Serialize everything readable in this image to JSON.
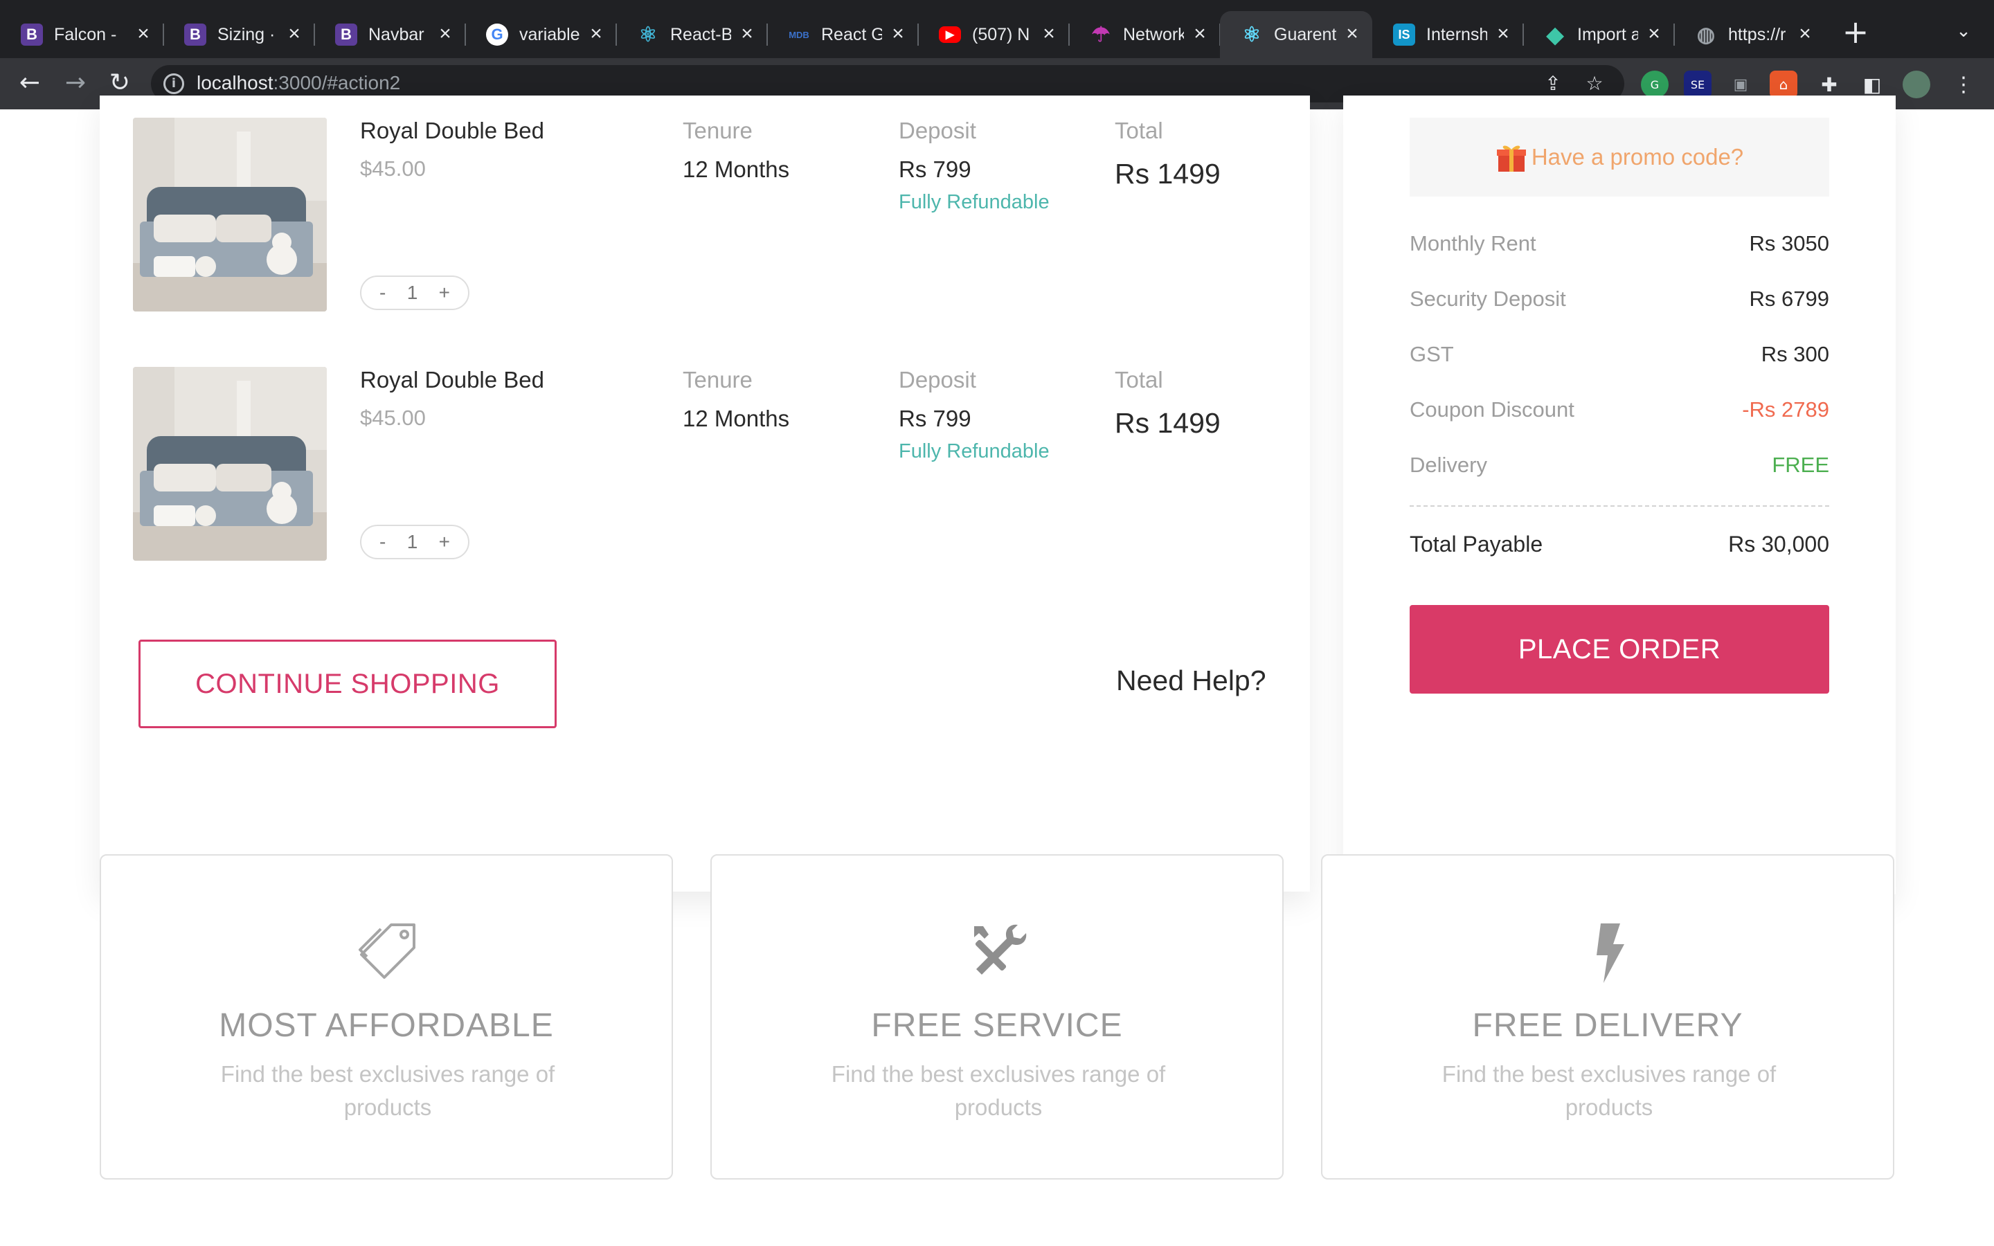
{
  "browser": {
    "tabs": [
      {
        "title": "Falcon -",
        "icon": "bootstrap-icon",
        "color": "#7952b3",
        "glyph": "B"
      },
      {
        "title": "Sizing ·",
        "icon": "bootstrap-icon",
        "color": "#7952b3",
        "glyph": "B"
      },
      {
        "title": "Navbar",
        "icon": "bootstrap-icon",
        "color": "#7952b3",
        "glyph": "B"
      },
      {
        "title": "variable",
        "icon": "google-icon",
        "color": "#ffffff",
        "glyph": "G"
      },
      {
        "title": "React-B",
        "icon": "react-bootstrap-icon",
        "color": "#41b3d3",
        "glyph": "⚛"
      },
      {
        "title": "React G",
        "icon": "mdb-icon",
        "color": "#3b71ca",
        "glyph": "MDB"
      },
      {
        "title": "(507) N",
        "icon": "youtube-icon",
        "color": "#ff0000",
        "glyph": "▶"
      },
      {
        "title": "Network",
        "icon": "umbrella-icon",
        "color": "#c239b3",
        "glyph": "☂"
      },
      {
        "title": "Guarent",
        "icon": "react-icon",
        "color": "#61dafb",
        "glyph": "⚛"
      },
      {
        "title": "Internsh",
        "icon": "internshala-icon",
        "color": "#1295c9",
        "glyph": "IS"
      },
      {
        "title": "Import a",
        "icon": "diamond-icon",
        "color": "#3ec6a8",
        "glyph": "◆"
      },
      {
        "title": "https://r",
        "icon": "globe-icon",
        "color": "#9aa0a6",
        "glyph": "◍"
      }
    ],
    "active_tab": 8,
    "url_host": "localhost",
    "url_rest": ":3000/#action2"
  },
  "cart": {
    "items": [
      {
        "name": "Royal Double Bed",
        "price": "$45.00",
        "tenure_label": "Tenure",
        "tenure": "12 Months",
        "deposit_label": "Deposit",
        "deposit": "Rs 799",
        "refund": "Fully Refundable",
        "total_label": "Total",
        "total": "Rs 1499",
        "qty": "1"
      },
      {
        "name": "Royal Double Bed",
        "price": "$45.00",
        "tenure_label": "Tenure",
        "tenure": "12 Months",
        "deposit_label": "Deposit",
        "deposit": "Rs 799",
        "refund": "Fully Refundable",
        "total_label": "Total",
        "total": "Rs 1499",
        "qty": "1"
      }
    ],
    "qty_minus": "-",
    "qty_plus": "+",
    "continue_label": "CONTINUE SHOPPING",
    "help_label": "Need Help?"
  },
  "summary": {
    "promo_label": "Have a promo code?",
    "rows": [
      {
        "label": "Monthly Rent",
        "value": "Rs 3050"
      },
      {
        "label": "Security Deposit",
        "value": "Rs 6799"
      },
      {
        "label": "GST",
        "value": "Rs 300"
      },
      {
        "label": "Coupon Discount",
        "value": "-Rs 2789"
      },
      {
        "label": "Delivery",
        "value": "FREE"
      }
    ],
    "total_label": "Total Payable",
    "total_value": "Rs 30,000",
    "place_order_label": "PLACE ORDER",
    "colors": {
      "discount": "#f06a4f",
      "free": "#4caf50",
      "accent": "#d93a67"
    }
  },
  "features": [
    {
      "icon": "price-tag-icon",
      "title": "MOST AFFORDABLE",
      "desc": "Find the best exclusives range of products"
    },
    {
      "icon": "tools-icon",
      "title": "FREE SERVICE",
      "desc": "Find the best exclusives range of products"
    },
    {
      "icon": "lightning-icon",
      "title": "FREE DELIVERY",
      "desc": "Find the best exclusives range of products"
    }
  ]
}
